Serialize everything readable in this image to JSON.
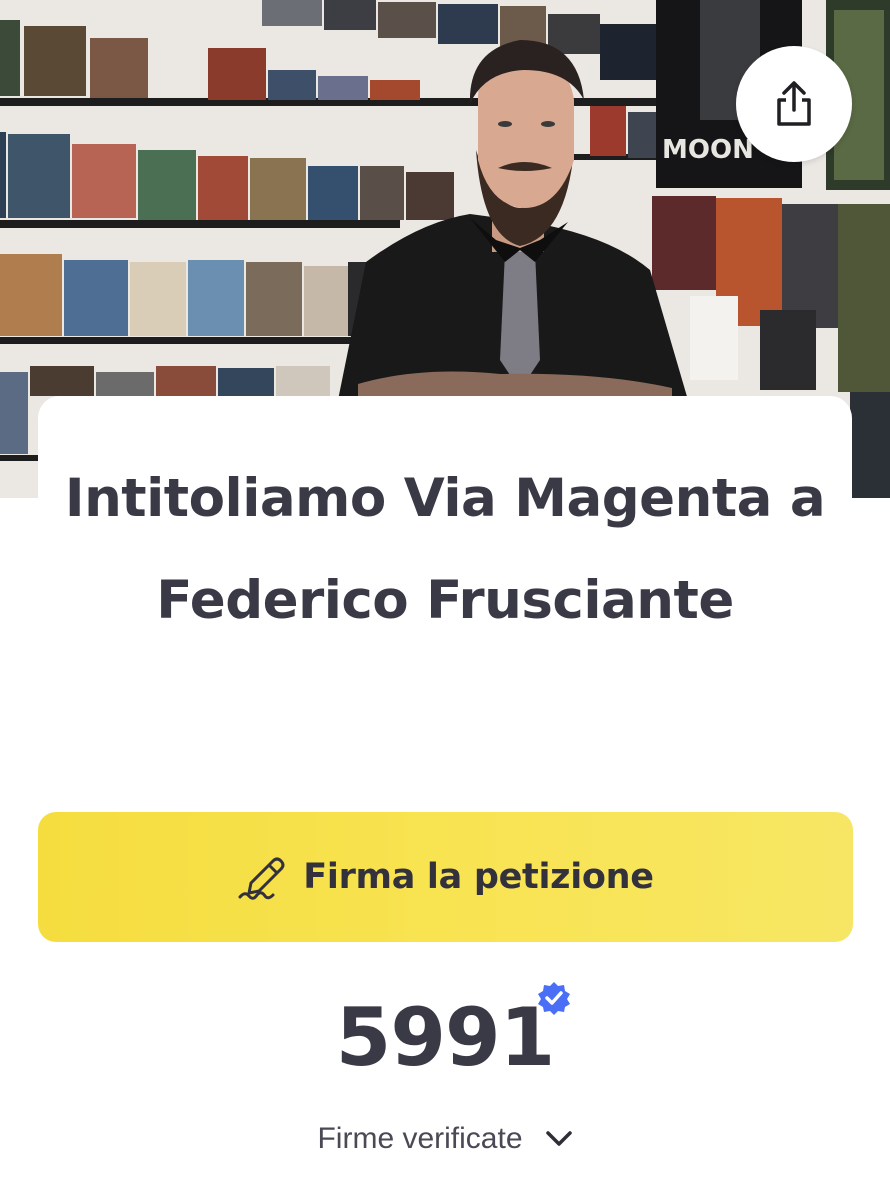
{
  "hero": {
    "poster_text": "MOON"
  },
  "header": {
    "share_icon": "share-icon"
  },
  "petition": {
    "title": "Intitoliamo Via Magenta a Federico Frusciante"
  },
  "sign_button": {
    "icon": "signature-pen-icon",
    "label": "Firma la petizione",
    "color": "#f6e04a"
  },
  "signatures": {
    "count": "5991",
    "verified_icon": "verified-badge-icon",
    "verified_color": "#4a6ef5",
    "label": "Firme verificate",
    "toggle_icon": "chevron-down-icon"
  }
}
